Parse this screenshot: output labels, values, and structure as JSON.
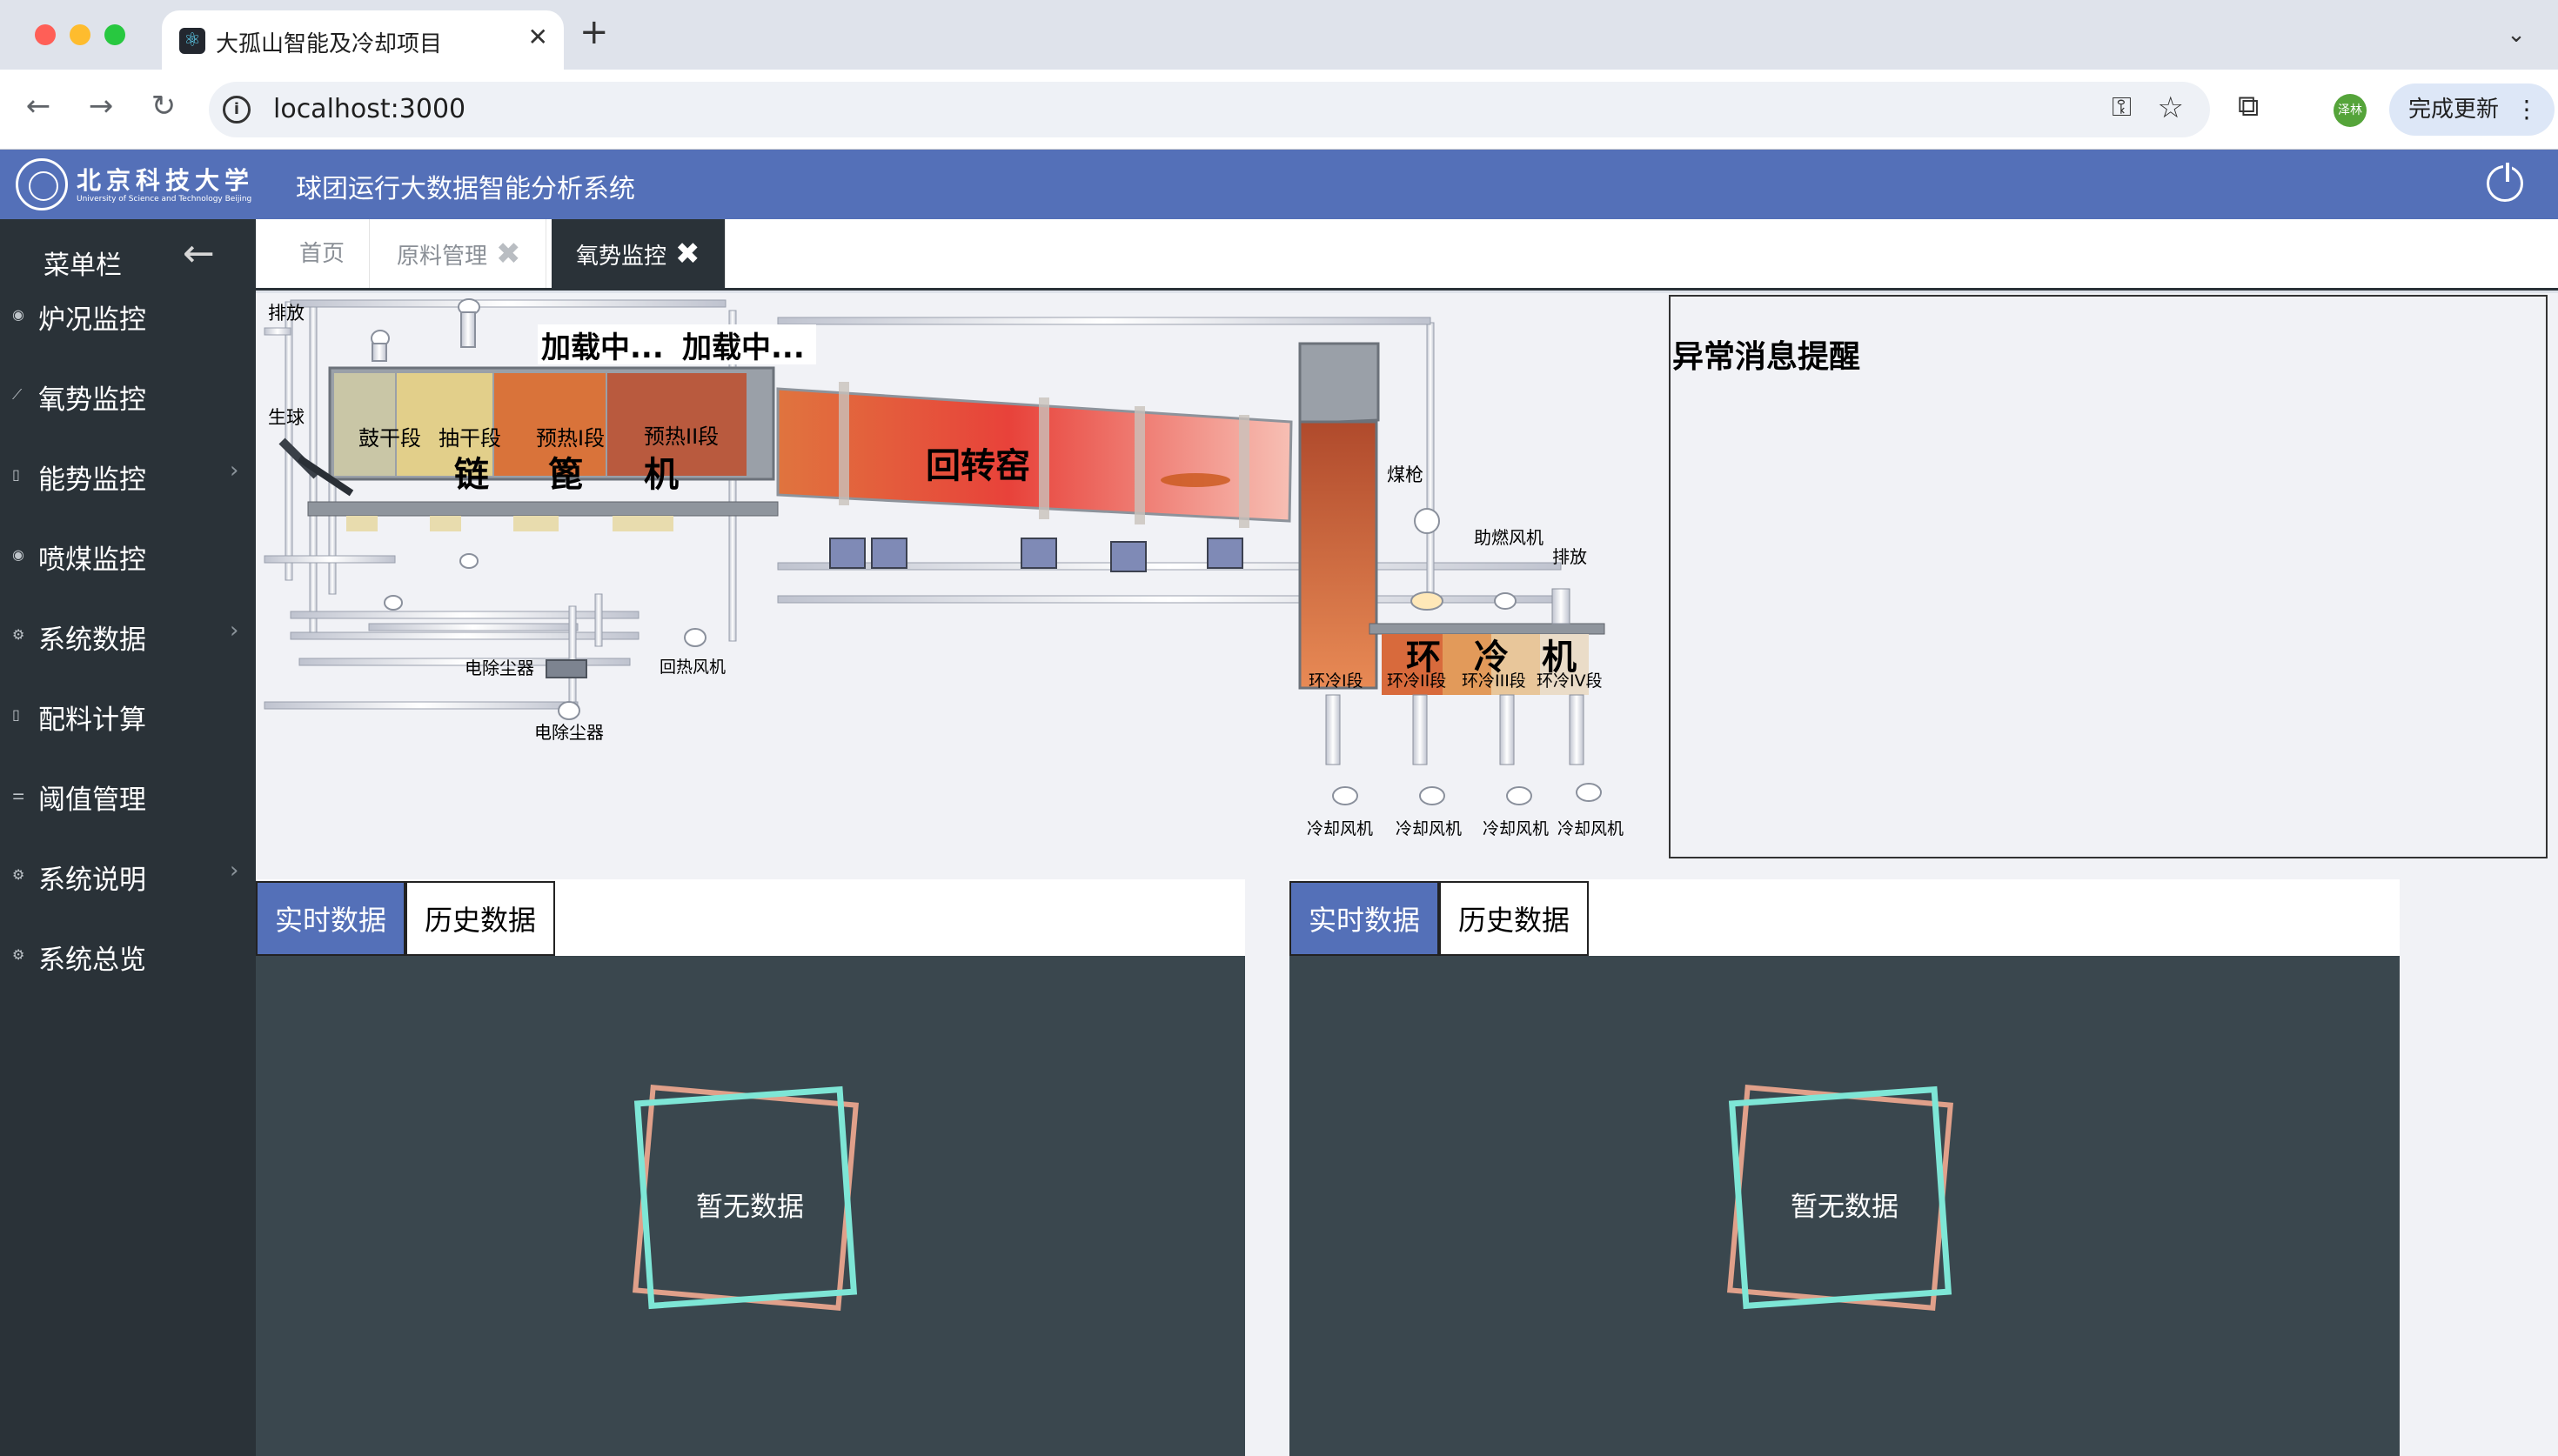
{
  "browser": {
    "tab_title": "大孤山智能及冷却项目",
    "tab_close": "✕",
    "new_tab": "+",
    "url": "localhost:3000",
    "avatar_text": "泽林",
    "update_button": "完成更新",
    "icons": [
      "back-icon",
      "forward-icon",
      "reload-icon",
      "info-icon",
      "key-icon",
      "star-icon",
      "extensions-icon",
      "menu-dots-icon"
    ]
  },
  "header": {
    "logo_cn": "北京科技大学",
    "logo_en": "University of Science and Technology Beijing",
    "title": "球团运行大数据智能分析系统",
    "power_icon": "power-icon",
    "color": "#5470b8"
  },
  "sidebar": {
    "title": "菜单栏",
    "collapse_icon": "←",
    "items": [
      {
        "label": "炉况监控",
        "icon": "eye-icon",
        "has_submenu": false
      },
      {
        "label": "氧势监控",
        "icon": "chart-icon",
        "has_submenu": false
      },
      {
        "label": "能势监控",
        "icon": "doc-icon",
        "has_submenu": true
      },
      {
        "label": "喷煤监控",
        "icon": "eye-icon",
        "has_submenu": false
      },
      {
        "label": "系统数据",
        "icon": "gear-icon",
        "has_submenu": true
      },
      {
        "label": "配料计算",
        "icon": "doc-icon",
        "has_submenu": false
      },
      {
        "label": "阈值管理",
        "icon": "sliders-icon",
        "has_submenu": false
      },
      {
        "label": "系统说明",
        "icon": "settings-icon",
        "has_submenu": true
      },
      {
        "label": "系统总览",
        "icon": "settings-icon",
        "has_submenu": false
      }
    ],
    "arrow": "›",
    "color": "#2a3238"
  },
  "page_tabs": [
    {
      "label": "首页",
      "closable": false,
      "active": false
    },
    {
      "label": "原料管理",
      "closable": true,
      "active": false
    },
    {
      "label": "氧势监控",
      "closable": true,
      "active": true
    }
  ],
  "tab_close_glyph": "✖",
  "process": {
    "discharge_top": "排放",
    "green_pellet": "生球",
    "loading_1": "加载中...",
    "loading_2": "加载中...",
    "grate_sections": [
      "鼓干段",
      "抽干段",
      "预热I段",
      "预热II段"
    ],
    "grate_big": [
      "链",
      "篦",
      "机"
    ],
    "kiln": "回转窑",
    "coal_gun": "煤枪",
    "combustion_fan": "助燃风机",
    "discharge_right": "排放",
    "cooler_big": [
      "环",
      "冷",
      "机"
    ],
    "cooler_sections": [
      "环冷I段",
      "环冷II段",
      "环冷III段",
      "环冷IV段"
    ],
    "cooling_fans": [
      "冷却风机",
      "冷却风机",
      "冷却风机",
      "冷却风机"
    ],
    "esp_1": "电除尘器",
    "esp_2": "电除尘器",
    "return_fan": "回热风机"
  },
  "alert": {
    "title": "异常消息提醒"
  },
  "panels": [
    {
      "tab_realtime": "实时数据",
      "tab_history": "历史数据",
      "empty_text": "暂无数据"
    },
    {
      "tab_realtime": "实时数据",
      "tab_history": "历史数据",
      "empty_text": "暂无数据"
    }
  ]
}
